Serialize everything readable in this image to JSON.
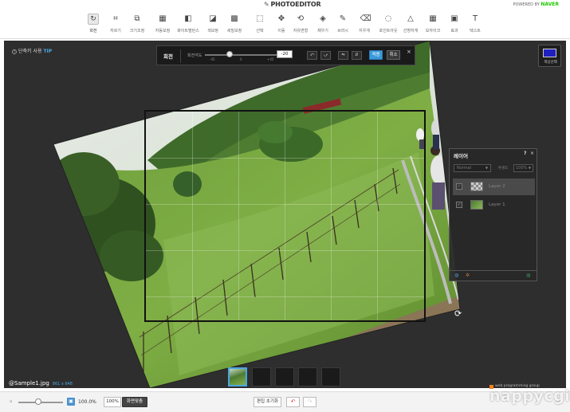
{
  "app": {
    "logo": "PHOTOEDITOR",
    "powered_by": "POWERED BY",
    "powered_brand": "NAVER"
  },
  "toolbar": {
    "tools": [
      {
        "id": "rotate",
        "label": "회전",
        "icon": "rotate-icon",
        "glyph": "↻",
        "active": true
      },
      {
        "id": "crop",
        "label": "자르기",
        "icon": "crop-icon",
        "glyph": "⌗"
      },
      {
        "id": "resize",
        "label": "크기조정",
        "icon": "resize-icon",
        "glyph": "⧉"
      },
      {
        "id": "auto",
        "label": "자동보정",
        "icon": "auto-correct-icon",
        "glyph": "▦"
      },
      {
        "id": "whitebalance",
        "label": "화이트밸런스",
        "icon": "white-balance-icon",
        "glyph": "◧"
      },
      {
        "id": "color",
        "label": "색보정",
        "icon": "color-correct-icon",
        "glyph": "◪"
      },
      {
        "id": "detail",
        "label": "세밀보정",
        "icon": "detail-correct-icon",
        "glyph": "▩"
      },
      {
        "id": "select",
        "label": "선택",
        "icon": "select-icon",
        "glyph": "⬚"
      },
      {
        "id": "move",
        "label": "이동",
        "icon": "move-icon",
        "glyph": "✥"
      },
      {
        "id": "transform",
        "label": "자유변형",
        "icon": "transform-icon",
        "glyph": "⟲"
      },
      {
        "id": "fill",
        "label": "채우기",
        "icon": "fill-icon",
        "glyph": "◈"
      },
      {
        "id": "brush",
        "label": "브러시",
        "icon": "brush-icon",
        "glyph": "✎"
      },
      {
        "id": "eraser",
        "label": "지우개",
        "icon": "eraser-icon",
        "glyph": "⌫"
      },
      {
        "id": "softfocus",
        "label": "포인트아웃",
        "icon": "soft-focus-icon",
        "glyph": "◌"
      },
      {
        "id": "sharpen",
        "label": "선명하게",
        "icon": "sharpen-icon",
        "glyph": "△"
      },
      {
        "id": "mosaic",
        "label": "모자이크",
        "icon": "mosaic-icon",
        "glyph": "▦"
      },
      {
        "id": "effect",
        "label": "효과",
        "icon": "effect-icon",
        "glyph": "▣"
      },
      {
        "id": "text",
        "label": "텍스트",
        "icon": "text-icon",
        "glyph": "T"
      }
    ]
  },
  "stage": {
    "tip_prefix": "단축키 사용",
    "tip_word": "TIP",
    "color_label": "색상선택",
    "file_name": "@Sample1.jpg",
    "file_dims": "861 x 648"
  },
  "rotate_panel": {
    "title": "회전",
    "angle_label": "회전각도",
    "tick_min": "-45",
    "tick_mid": "0",
    "tick_max": "+45",
    "value": "-20",
    "apply": "적용",
    "cancel": "취소",
    "close": "×"
  },
  "layers_panel": {
    "title": "레이어",
    "help": "?",
    "close": "×",
    "blend_mode": "Normal",
    "opacity_label": "투명도",
    "opacity_value": "100%",
    "layers": [
      {
        "name": "Layer 2",
        "selected": true
      },
      {
        "name": "Layer 1",
        "selected": false
      }
    ]
  },
  "bottom": {
    "zoom_value": "100.0%",
    "btn_actual": "100%",
    "btn_fit": "화면맞춤",
    "btn_reset": "편집 초기화"
  },
  "watermark": {
    "small": "web programming group",
    "big": "nappycgi"
  }
}
